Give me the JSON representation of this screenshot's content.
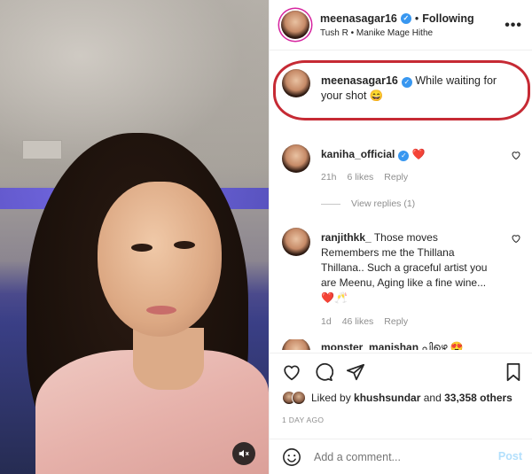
{
  "post": {
    "username": "meenasagar16",
    "following_label": "Following",
    "audio": "Tush R • Manike Mage Hithe",
    "more_label": "•••"
  },
  "caption": {
    "username": "meenasagar16",
    "text": "While waiting for your shot 😄"
  },
  "comments": [
    {
      "username": "kaniha_official",
      "text": "❤️",
      "age": "21h",
      "likes": "6 likes",
      "reply_label": "Reply",
      "view_replies": "View replies (1)"
    },
    {
      "username": "ranjithkk_",
      "text": "Those moves Remembers me the Thillana Thillana.. Such a graceful artist you are Meenu, Aging like a fine wine... ❤️🥂",
      "age": "1d",
      "likes": "46 likes",
      "reply_label": "Reply"
    },
    {
      "username": "monster_manishan",
      "text": "പിഴെ 😍"
    }
  ],
  "likes": {
    "prefix": "Liked by",
    "user": "khushsundar",
    "connector": "and",
    "others": "33,358 others"
  },
  "time_ago": "1 DAY AGO",
  "add_comment": {
    "placeholder": "Add a comment...",
    "post_label": "Post"
  },
  "colors": {
    "verified": "#3897f0",
    "highlight_ring": "#c62a34",
    "post_button": "#b2dffc",
    "meta_text": "#8e8e8e"
  },
  "icons": [
    "heart-icon",
    "comment-icon",
    "share-icon",
    "save-icon",
    "emoji-icon",
    "mute-icon",
    "more-icon"
  ]
}
